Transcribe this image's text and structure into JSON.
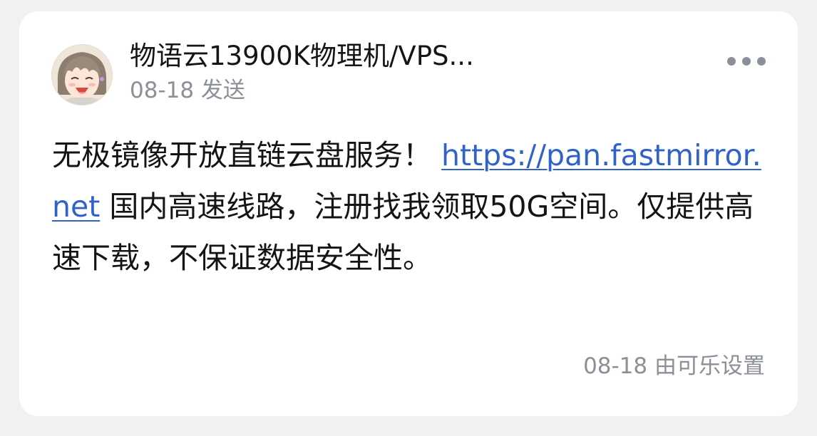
{
  "post": {
    "sender": "物语云13900K物理机/VPS...",
    "date_sent": "08-18 发送",
    "more_icon": "more-horizontal-icon",
    "avatar": "anime-avatar",
    "message": {
      "text_before": "无极镜像开放直链云盘服务！ ",
      "link": "https://pan.fastmirror.net",
      "text_after": " 国内高速线路，注册找我领取50G空间。仅提供高速下载，不保证数据安全性。"
    },
    "footer": "08-18 由可乐设置"
  },
  "colors": {
    "background": "#f1f1f3",
    "card": "#ffffff",
    "link": "#2f63c9",
    "secondary_text": "#8b8f96"
  }
}
